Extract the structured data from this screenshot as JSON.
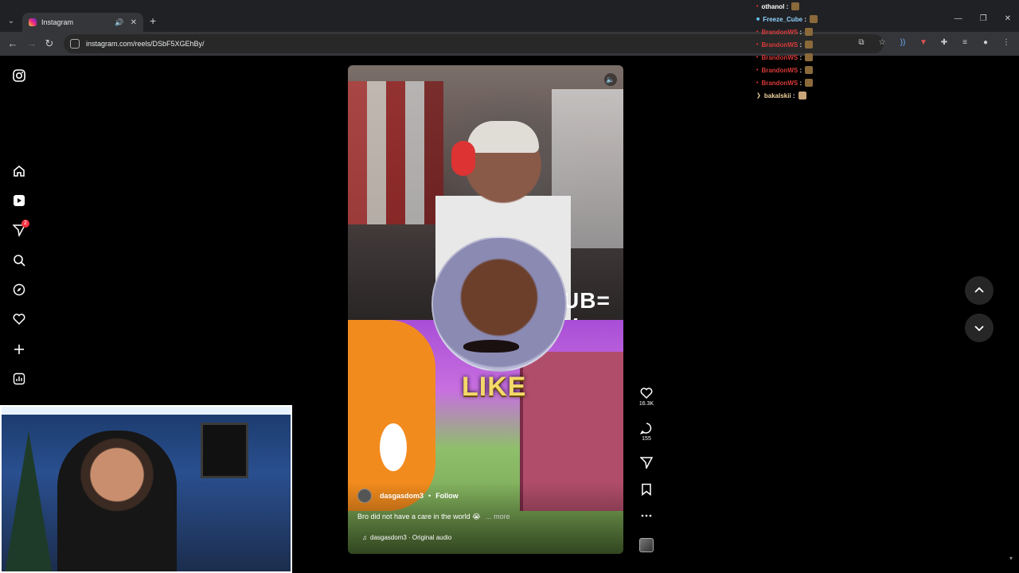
{
  "browser": {
    "tab_title": "Instagram",
    "url": "instagram.com/reels/DSbF5XGEhBy/"
  },
  "sidebar": {
    "notification_badge": "2"
  },
  "reel": {
    "overlay_sub": "UB= V",
    "overlay_like": "LIKE",
    "author": "dasgasdom3",
    "follow_label": "Follow",
    "caption": "Bro did not have a care in the world 😭",
    "caption_more": "... more",
    "audio": "dasgasdom3 · Original audio"
  },
  "actions": {
    "like_count": "16.3K",
    "comment_count": "155"
  },
  "chat": [
    {
      "user": "othanol",
      "color": "#ffffff"
    },
    {
      "user": "Freeze_Cube",
      "color": "#8fd3ff"
    },
    {
      "user": "BrandonWS",
      "color": "#d93a3a"
    },
    {
      "user": "BrandonWS",
      "color": "#d93a3a"
    },
    {
      "user": "BrandonWS",
      "color": "#d93a3a"
    },
    {
      "user": "BrandonWS",
      "color": "#d93a3a"
    },
    {
      "user": "BrandonWS",
      "color": "#d93a3a"
    },
    {
      "user": "bakalskii",
      "color": "#f2d4a0"
    }
  ],
  "colors": {
    "chrome_bg": "#202124",
    "toolbar_bg": "#35363a",
    "badge": "#ff3040"
  }
}
